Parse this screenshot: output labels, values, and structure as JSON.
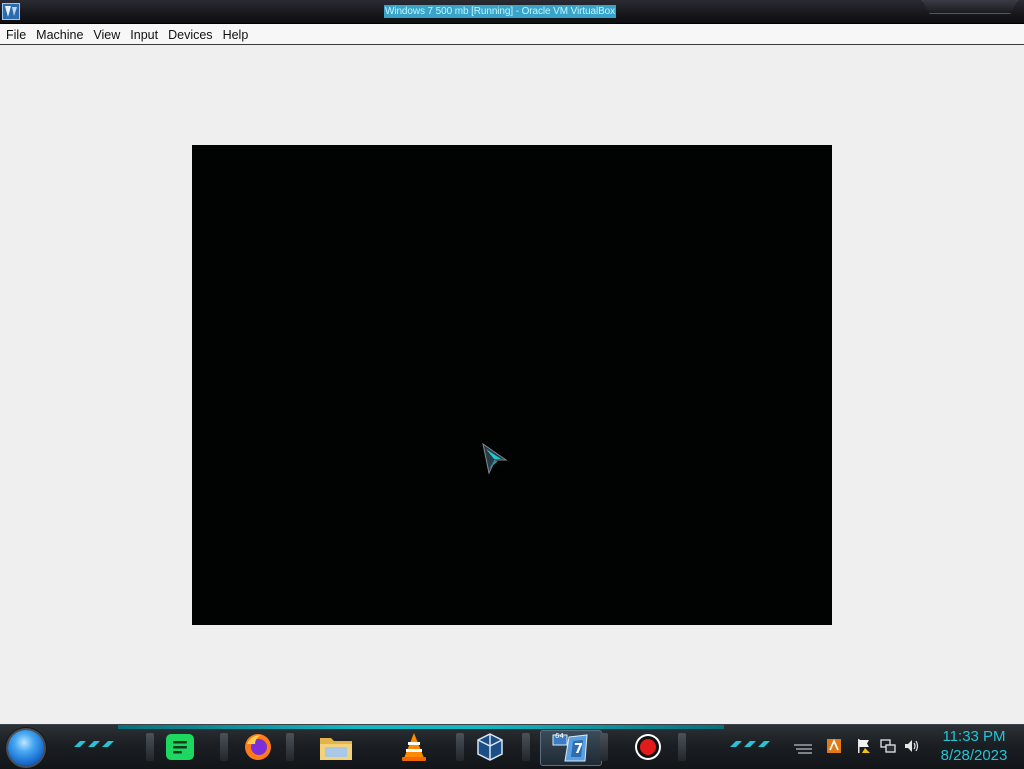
{
  "window": {
    "title": "Windows 7 500 mb [Running] - Oracle VM VirtualBox"
  },
  "menubar": {
    "items": [
      {
        "label": "File"
      },
      {
        "label": "Machine"
      },
      {
        "label": "View"
      },
      {
        "label": "Input"
      },
      {
        "label": "Devices"
      },
      {
        "label": "Help"
      }
    ]
  },
  "vm_screen": {
    "background": "#010303",
    "cursor_icon": "arrow-cursor-icon"
  },
  "taskbar": {
    "start_icon": "start-orb-icon",
    "pinned": [
      {
        "name": "spotify-icon",
        "active": false
      },
      {
        "name": "firefox-icon",
        "active": false
      },
      {
        "name": "file-explorer-icon",
        "active": false
      },
      {
        "name": "vlc-icon",
        "active": false
      },
      {
        "name": "virtualbox-icon",
        "active": false
      },
      {
        "name": "windows7-64bit-vm-icon",
        "active": true,
        "badge_top": "64",
        "badge_main": "7"
      },
      {
        "name": "screen-recorder-icon",
        "active": false
      }
    ],
    "tray": [
      {
        "name": "show-hidden-icons-icon"
      },
      {
        "name": "app-tray-icon"
      },
      {
        "name": "action-center-flag-icon"
      },
      {
        "name": "network-icon"
      },
      {
        "name": "volume-icon"
      }
    ],
    "clock": {
      "time": "11:33 PM",
      "date": "8/28/2023"
    },
    "accent_color": "#23c4d6"
  }
}
